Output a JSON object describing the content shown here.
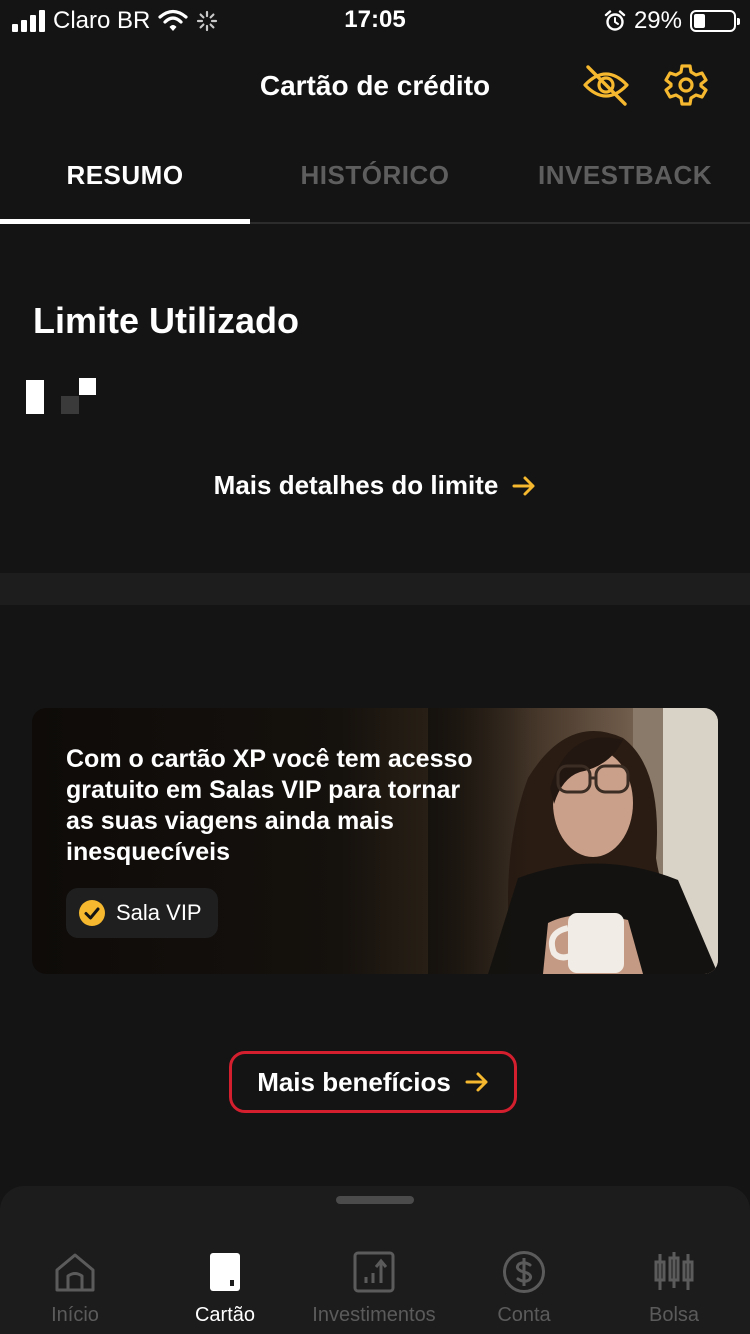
{
  "status_bar": {
    "carrier": "Claro BR",
    "time": "17:05",
    "battery": "29%",
    "battery_level": 0.29,
    "icons": [
      "signal-icon",
      "wifi-icon",
      "loading-icon",
      "alarm-icon",
      "battery-icon"
    ]
  },
  "header": {
    "title": "Cartão de crédito",
    "icons": [
      "hide-values-icon",
      "settings-icon"
    ]
  },
  "tabs": [
    {
      "label": "RESUMO",
      "active": true
    },
    {
      "label": "HISTÓRICO",
      "active": false
    },
    {
      "label": "INVESTBACK",
      "active": false
    }
  ],
  "limit": {
    "title": "Limite Utilizado",
    "details_link": "Mais detalhes do limite"
  },
  "promo": {
    "text": "Com o cartão XP você tem acesso gratuito em Salas VIP para tornar as suas viagens ainda mais inesquecíveis",
    "badge": "Sala VIP"
  },
  "benefits_link": "Mais benefícios",
  "bottom_nav": [
    {
      "label": "Início",
      "icon": "home-icon",
      "active": false
    },
    {
      "label": "Cartão",
      "icon": "card-icon",
      "active": true
    },
    {
      "label": "Investimentos",
      "icon": "investments-icon",
      "active": false
    },
    {
      "label": "Conta",
      "icon": "dollar-icon",
      "active": false
    },
    {
      "label": "Bolsa",
      "icon": "candlestick-icon",
      "active": false
    }
  ],
  "colors": {
    "background": "#141414",
    "accent": "#f5b82e",
    "highlight_border": "#d41f2f",
    "inactive_text": "#5e5e5e"
  }
}
